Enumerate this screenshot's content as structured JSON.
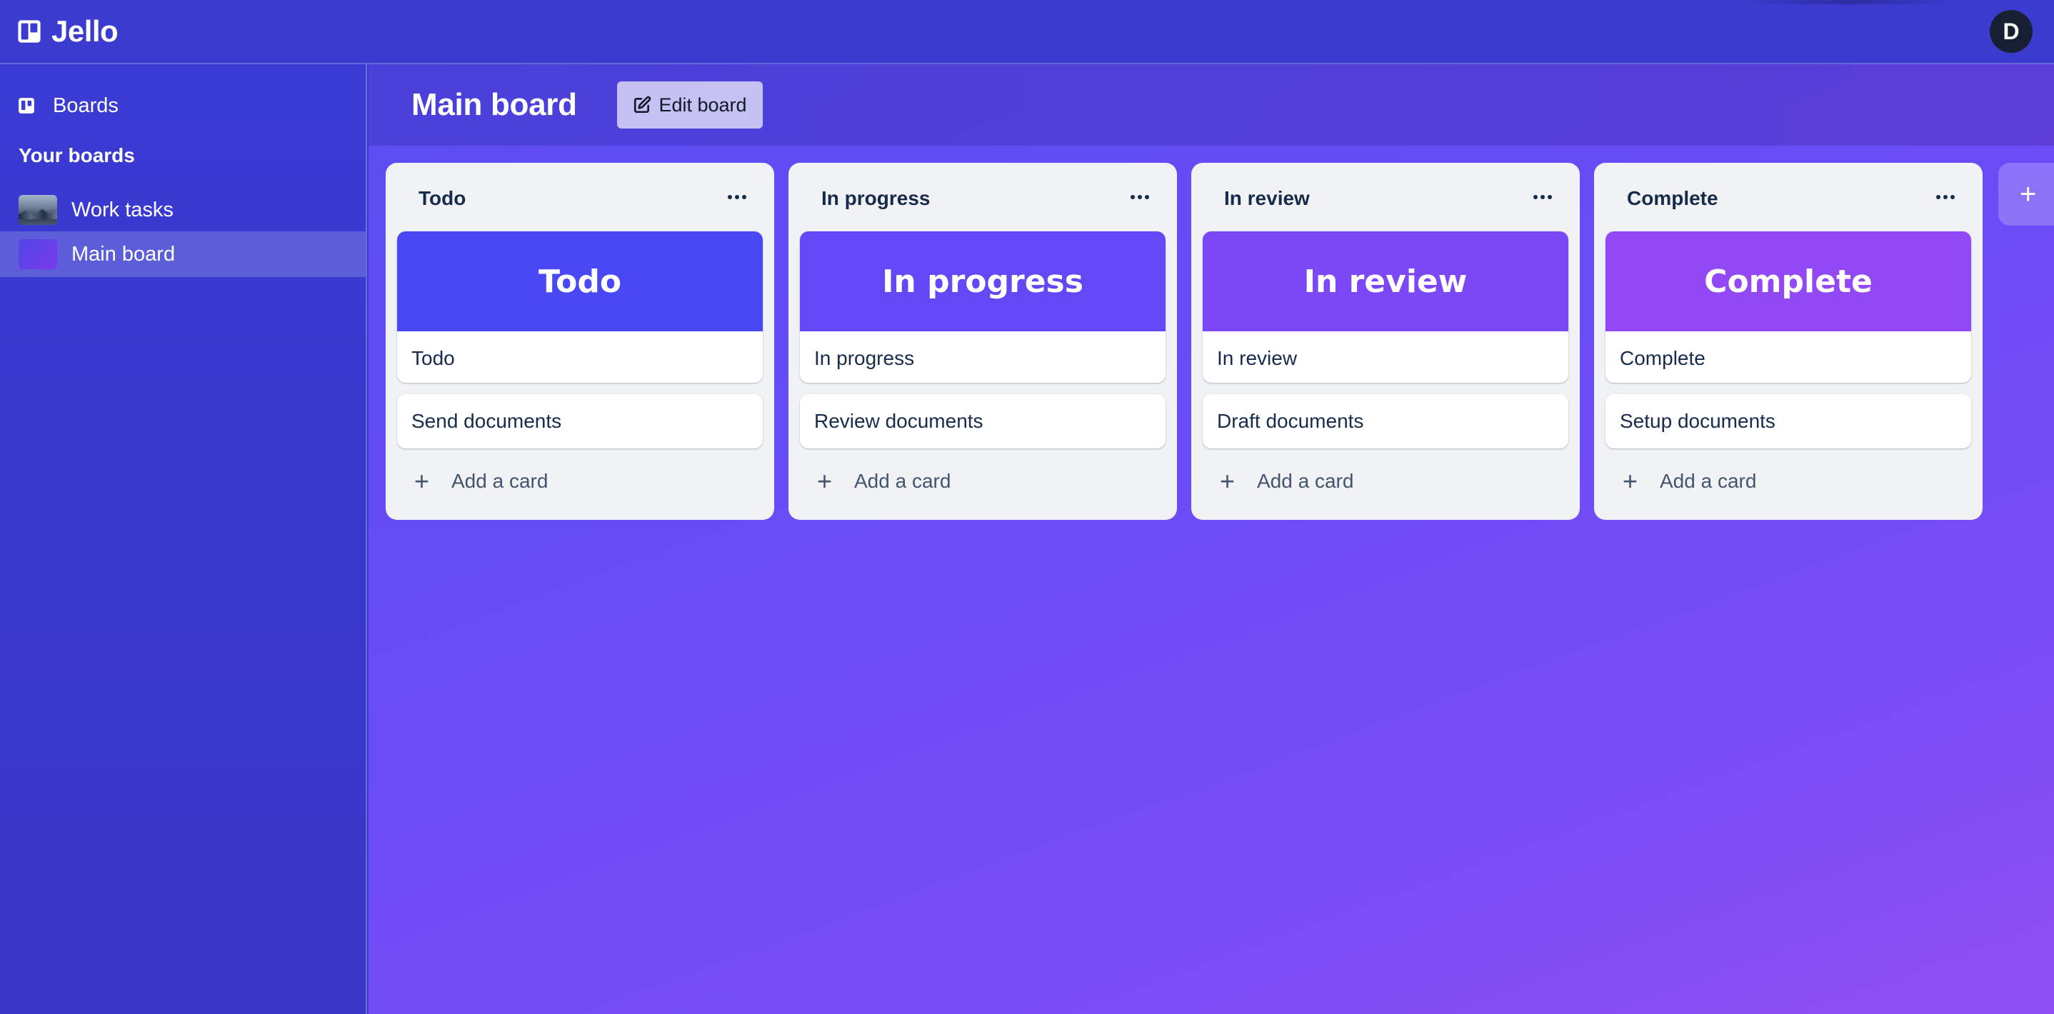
{
  "app": {
    "name": "Jello",
    "user_initial": "D"
  },
  "sidebar": {
    "boards_label": "Boards",
    "section_title": "Your boards",
    "items": [
      {
        "label": "Work tasks",
        "thumb": "mountain-photo",
        "active": false
      },
      {
        "label": "Main board",
        "thumb": "gradient",
        "active": true
      }
    ]
  },
  "board": {
    "title": "Main board",
    "edit_label": "Edit board",
    "lists": [
      {
        "title": "Todo",
        "cover_title": "Todo",
        "cover_color": "#4a48f5",
        "cover_card_text": "Todo",
        "card_text": "Send documents",
        "add_card_label": "Add a card"
      },
      {
        "title": "In progress",
        "cover_title": "In progress",
        "cover_color": "#6447f5",
        "cover_card_text": "In progress",
        "card_text": "Review documents",
        "add_card_label": "Add a card"
      },
      {
        "title": "In review",
        "cover_title": "In review",
        "cover_color": "#7c48f5",
        "cover_card_text": "In review",
        "card_text": "Draft documents",
        "add_card_label": "Add a card"
      },
      {
        "title": "Complete",
        "cover_title": "Complete",
        "cover_color": "#9248f5",
        "cover_card_text": "Complete",
        "card_text": "Setup documents",
        "add_card_label": "Add a card"
      }
    ],
    "add_list_symbol": "+"
  },
  "colors": {
    "header": "#3b3bcf",
    "sidebar": "#3a3bd3",
    "list_bg": "#f1f2f4",
    "avatar": "#172033"
  },
  "icons": {
    "logo": "jello-logo-icon",
    "boards": "trello-board-icon",
    "edit": "edit-pencil-icon",
    "list_menu": "more-horizontal-icon",
    "add": "plus-icon"
  }
}
